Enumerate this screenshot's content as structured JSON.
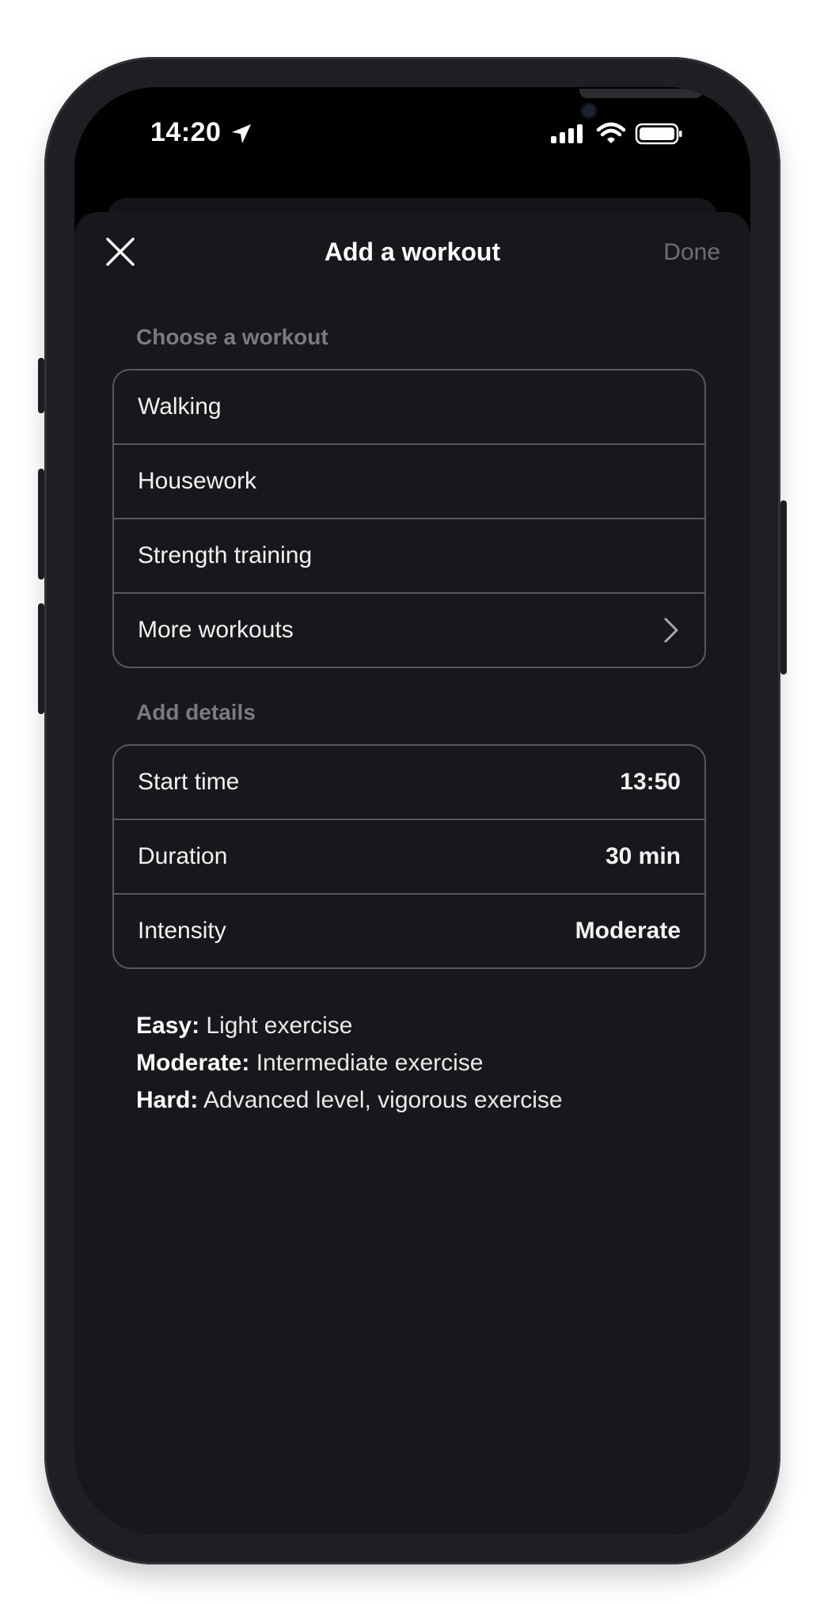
{
  "status_bar": {
    "time": "14:20",
    "location_icon": "location-arrow-icon",
    "signal_icon": "cellular-signal-icon",
    "wifi_icon": "wifi-icon",
    "battery_icon": "battery-icon"
  },
  "header": {
    "title": "Add a workout",
    "close_icon": "close-icon",
    "done_label": "Done"
  },
  "workouts": {
    "label": "Choose a workout",
    "items": [
      {
        "label": "Walking"
      },
      {
        "label": "Housework"
      },
      {
        "label": "Strength training"
      },
      {
        "label": "More workouts",
        "icon": "chevron-right-icon"
      }
    ]
  },
  "details": {
    "label": "Add details",
    "rows": [
      {
        "label": "Start time",
        "value": "13:50"
      },
      {
        "label": "Duration",
        "value": "30 min"
      },
      {
        "label": "Intensity",
        "value": "Moderate"
      }
    ]
  },
  "intensity_info": [
    {
      "term": "Easy:",
      "desc": " Light exercise"
    },
    {
      "term": "Moderate:",
      "desc": " Intermediate exercise"
    },
    {
      "term": "Hard:",
      "desc": " Advanced level, vigorous exercise"
    }
  ],
  "colors": {
    "background": "#17181b",
    "text": "#f2f2f3",
    "muted": "#7a7b7f",
    "border": "#57585c"
  }
}
